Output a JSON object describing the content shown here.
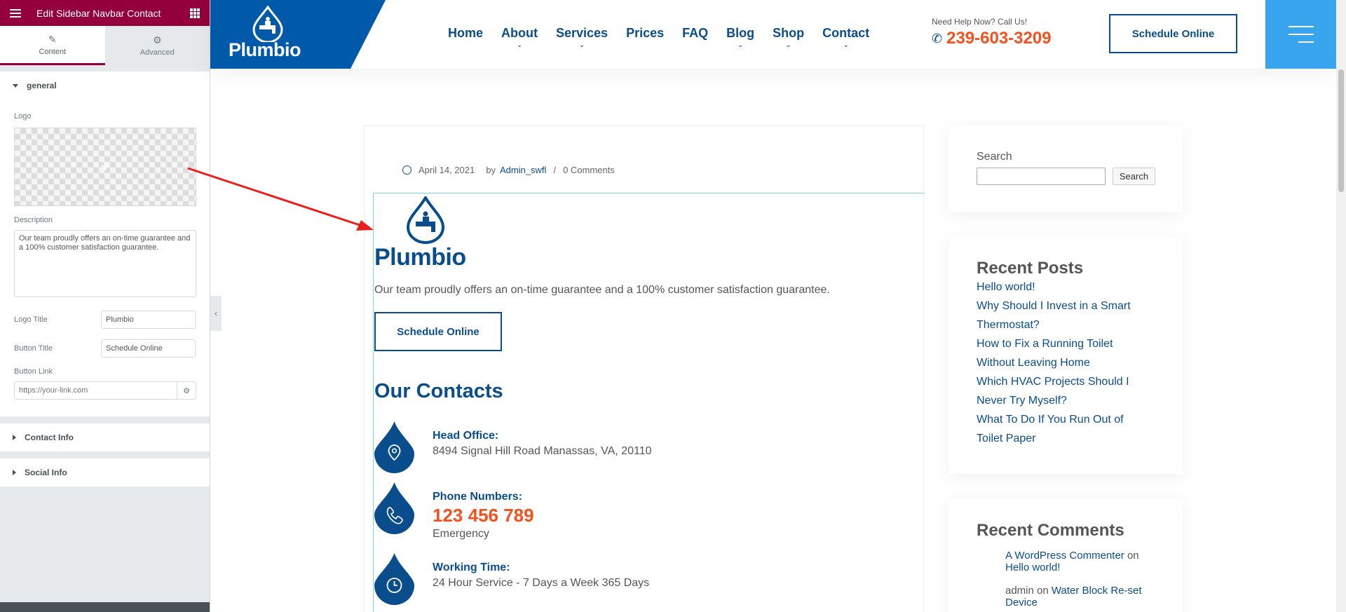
{
  "editor": {
    "title": "Edit Sidebar Navbar Contact",
    "tabs": [
      {
        "label": "Content",
        "icon": "pencil-icon"
      },
      {
        "label": "Advanced",
        "icon": "gear-icon"
      }
    ],
    "sections": {
      "general": "general",
      "contact_info": "Contact Info",
      "social_info": "Social Info"
    },
    "logo_label": "Logo",
    "description_label": "Description",
    "description_value": "Our team proudly offers an on-time guarantee and a 100% customer satisfaction guarantee.",
    "logo_title_label": "Logo Title",
    "logo_title_value": "Plumbio",
    "button_title_label": "Button Title",
    "button_title_value": "Schedule Online",
    "button_link_label": "Button Link",
    "button_link_placeholder": "https://your-link.com"
  },
  "header": {
    "logo_text": "Plumbio",
    "nav": [
      {
        "label": "Home",
        "has_sub": false
      },
      {
        "label": "About",
        "has_sub": true
      },
      {
        "label": "Services",
        "has_sub": true
      },
      {
        "label": "Prices",
        "has_sub": false
      },
      {
        "label": "FAQ",
        "has_sub": false
      },
      {
        "label": "Blog",
        "has_sub": true
      },
      {
        "label": "Shop",
        "has_sub": true
      },
      {
        "label": "Contact",
        "has_sub": true
      }
    ],
    "help_text": "Need Help Now? Call Us!",
    "phone": "239-603-3209",
    "cta": "Schedule Online"
  },
  "post": {
    "date": "April 14, 2021",
    "by": "by",
    "author": "Admin_swfl",
    "sep": "/",
    "comments": "0 Comments"
  },
  "widget": {
    "logo_text": "Plumbio",
    "description": "Our team proudly offers an on-time guarantee and a 100% customer satisfaction guarantee.",
    "button": "Schedule Online",
    "contacts_title": "Our Contacts",
    "contacts": [
      {
        "title": "Head Office:",
        "value": "8494 Signal Hill Road Manassas, VA, 20110",
        "icon": "location-pin-icon"
      },
      {
        "title": "Phone Numbers:",
        "big": "123 456 789",
        "sub": "Emergency",
        "icon": "phone-icon"
      },
      {
        "title": "Working Time:",
        "value": "24 Hour Service - 7 Days a Week 365 Days",
        "icon": "clock-icon"
      }
    ]
  },
  "sidebar": {
    "search_label": "Search",
    "search_button": "Search",
    "recent_posts_title": "Recent Posts",
    "recent_posts": [
      "Hello world!",
      "Why Should I Invest in a Smart Thermostat?",
      "How to Fix a Running Toilet Without Leaving Home",
      "Which HVAC Projects Should I Never Try Myself?",
      "What To Do If You Run Out of Toilet Paper"
    ],
    "recent_comments_title": "Recent Comments",
    "comments": [
      {
        "author": "A WordPress Commenter",
        "on": "on",
        "post": "Hello world!"
      },
      {
        "author": "admin",
        "on": "on",
        "post": "Water Block Re-set Device"
      }
    ]
  },
  "colors": {
    "brand_blue": "#0a4d8c",
    "accent_orange": "#f4511e",
    "editor_maroon": "#93003c",
    "toggle_blue": "#3aa5ef",
    "arrow_red": "#e8201e"
  }
}
